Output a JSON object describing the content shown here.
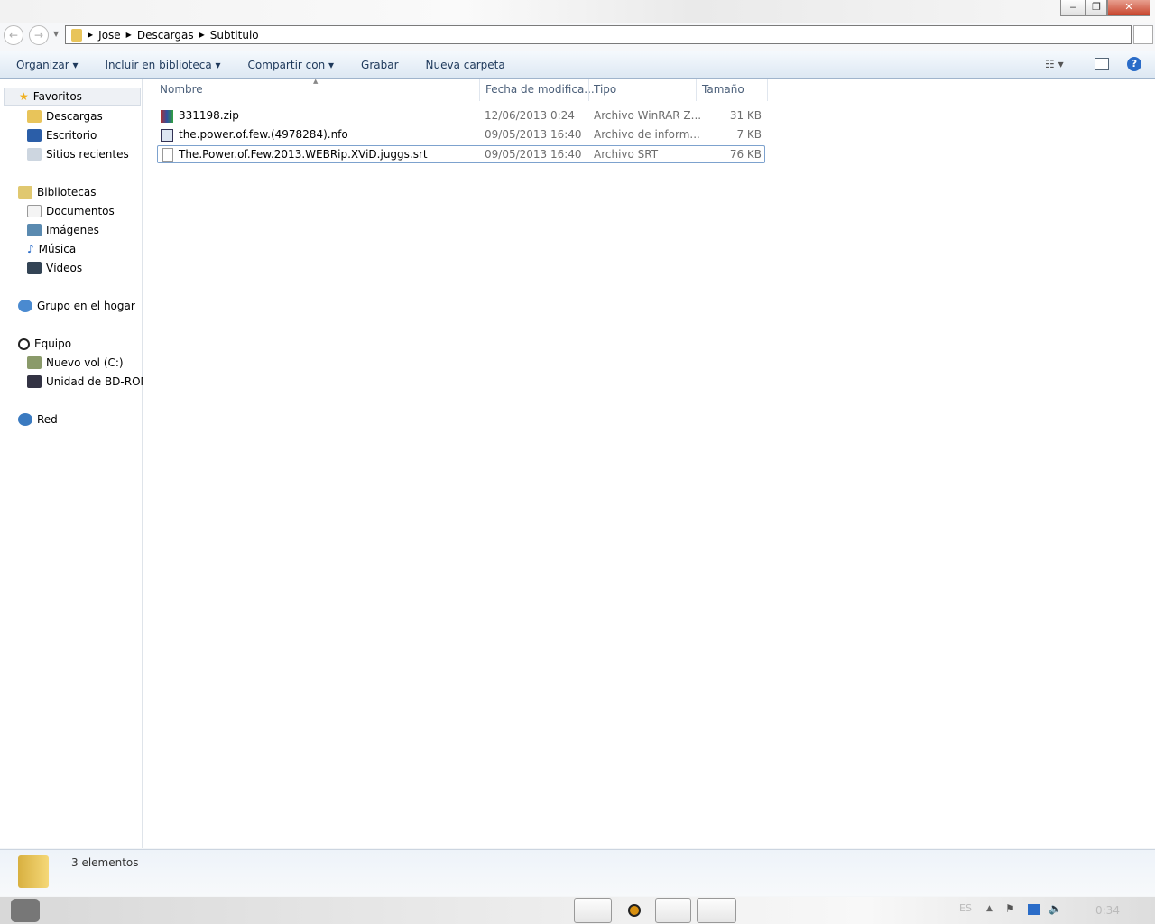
{
  "window": {
    "minimize": "‒",
    "restore": "❐",
    "close": "✕"
  },
  "address": {
    "crumbs": [
      "Jose",
      "Descargas",
      "Subtitulo"
    ]
  },
  "toolbar": {
    "organize": "Organizar ▾",
    "library": "Incluir en biblioteca ▾",
    "share": "Compartir con ▾",
    "burn": "Grabar",
    "new_folder": "Nueva carpeta",
    "help": "?"
  },
  "sidebar": {
    "favorites": "Favoritos",
    "fav_items": [
      "Descargas",
      "Escritorio",
      "Sitios recientes"
    ],
    "libraries": "Bibliotecas",
    "lib_items": [
      "Documentos",
      "Imágenes",
      "Música",
      "Vídeos"
    ],
    "homegroup": "Grupo en el hogar",
    "computer": "Equipo",
    "comp_items": [
      "Nuevo vol (C:)",
      "Unidad de BD-ROM"
    ],
    "network": "Red"
  },
  "columns": {
    "name": "Nombre",
    "date": "Fecha de modifica...",
    "type": "Tipo",
    "size": "Tamaño"
  },
  "files": [
    {
      "name": "331198.zip",
      "date": "12/06/2013 0:24",
      "type": "Archivo WinRAR Z...",
      "size": "31 KB"
    },
    {
      "name": "the.power.of.few.(4978284).nfo",
      "date": "09/05/2013 16:40",
      "type": "Archivo de inform...",
      "size": "7 KB"
    },
    {
      "name": "The.Power.of.Few.2013.WEBRip.XViD.juggs.srt",
      "date": "09/05/2013 16:40",
      "type": "Archivo SRT",
      "size": "76 KB"
    }
  ],
  "status": {
    "count": "3 elementos"
  },
  "taskbar": {
    "lang": "ES",
    "clock": "0:34"
  }
}
